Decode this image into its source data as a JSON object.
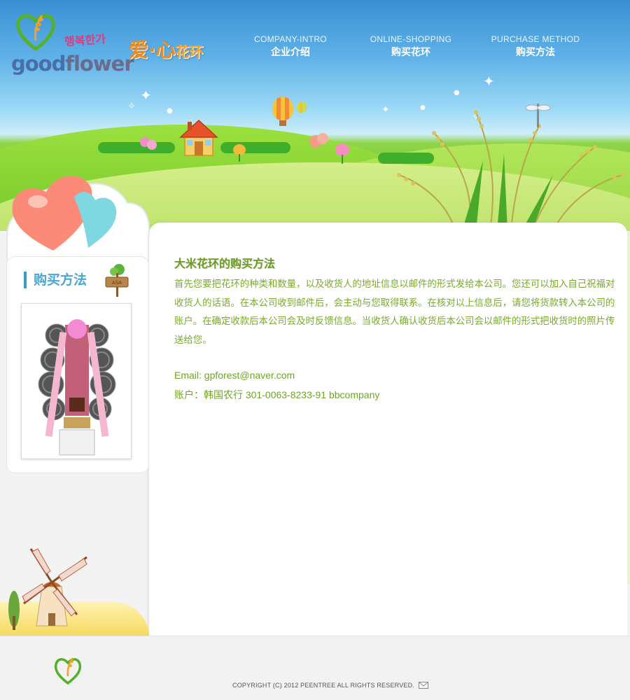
{
  "header": {
    "logo": {
      "word_good": "good",
      "word_flower": "flower",
      "korean_tagline": "행복한가"
    },
    "brand_cn_main": "爱·心",
    "brand_cn_sub": "花环"
  },
  "nav": {
    "items": [
      {
        "en": "COMPANY-INTRO",
        "cn": "企业介绍"
      },
      {
        "en": "ONLINE-SHOPPING",
        "cn": "购买花环"
      },
      {
        "en": "PURCHASE METHOD",
        "cn": "购买方法"
      }
    ]
  },
  "sidebar": {
    "title": "购买方法",
    "sign_label": "ASA"
  },
  "main": {
    "title": "大米花环的购买方法",
    "body": "首先您要把花环的种类和数量，以及收货人的地址信息以邮件的形式发给本公司。您还可以加入自己祝福对收货人的话语。在本公司收到邮件后，会主动与您取得联系。在核对以上信息后，请您将货款转入本公司的账户。在确定收款后本公司会及时反馈信息。当收货人确认收货后本公司会以邮件的形式把收货时的照片传送给您。",
    "email_line": "Email: gpforest@naver.com",
    "account_line": "账户：韩国农行 301-0063-8233-91 bbcompany"
  },
  "footer": {
    "copyright": "COPYRIGHT (C) 2012 PEENTREE  ALL RIGHTS RESERVED."
  },
  "colors": {
    "title_green": "#6a9c1f",
    "body_green": "#7aaa2c",
    "sidebar_blue": "#49a7d3",
    "brand_orange": "#f18a1d"
  }
}
